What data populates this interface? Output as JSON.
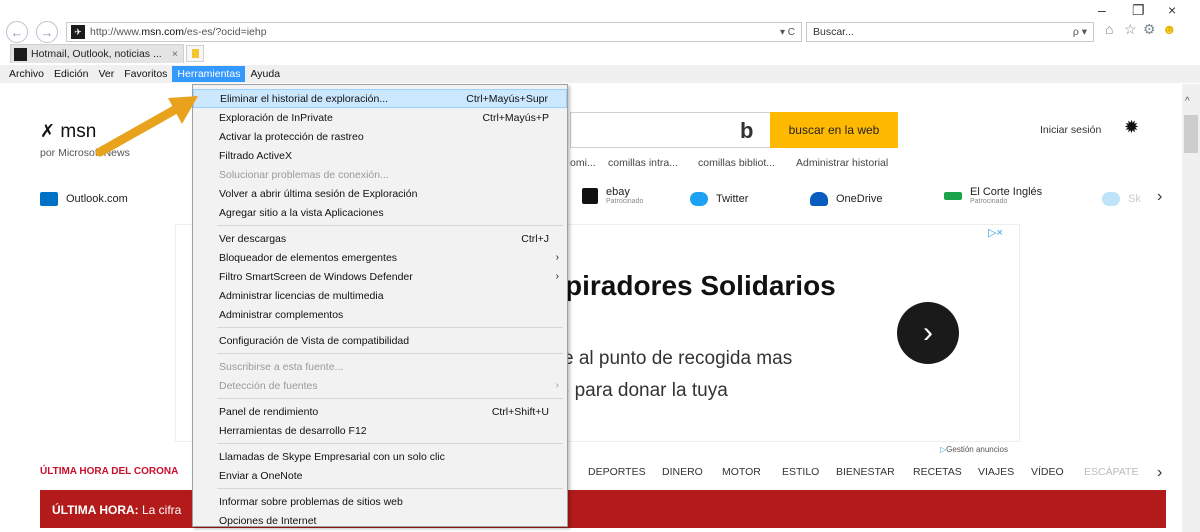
{
  "browser": {
    "url_prefix": "http://www.",
    "url_domain": "msn.com",
    "url_rest": "/es-es/?ocid=iehp",
    "address_controls": "▾ C",
    "search_placeholder": "Buscar...",
    "search_controls": "ρ ▾",
    "tab_title": "Hotmail, Outlook, noticias ...",
    "tab_close": "×",
    "window_controls": {
      "minimize": "–",
      "restore": "❐",
      "close": "×"
    },
    "nav_back": "←",
    "nav_forward": "→"
  },
  "menubar": [
    "Archivo",
    "Edición",
    "Ver",
    "Favoritos",
    "Herramientas",
    "Ayuda"
  ],
  "menubar_active": "Herramientas",
  "tools_menu": [
    {
      "label": "Eliminar el historial de exploración...",
      "shortcut": "Ctrl+Mayús+Supr",
      "highlight": true
    },
    {
      "label": "Exploración de InPrivate",
      "shortcut": "Ctrl+Mayús+P"
    },
    {
      "label": "Activar la protección de rastreo",
      "shortcut": ""
    },
    {
      "label": "Filtrado ActiveX",
      "shortcut": ""
    },
    {
      "label": "Solucionar problemas de conexión...",
      "shortcut": "",
      "disabled": true
    },
    {
      "label": "Volver a abrir última sesión de Exploración",
      "shortcut": ""
    },
    {
      "label": "Agregar sitio a la vista Aplicaciones",
      "shortcut": ""
    },
    {
      "label": "Ver descargas",
      "shortcut": "Ctrl+J"
    },
    {
      "label": "Bloqueador de elementos emergentes",
      "shortcut": "",
      "submenu": true
    },
    {
      "label": "Filtro SmartScreen de Windows Defender",
      "shortcut": "",
      "submenu": true
    },
    {
      "label": "Administrar licencias de multimedia",
      "shortcut": ""
    },
    {
      "label": "Administrar complementos",
      "shortcut": ""
    },
    {
      "label": "Configuración de Vista de compatibilidad",
      "shortcut": ""
    },
    {
      "label": "Suscribirse a esta fuente...",
      "shortcut": "",
      "disabled": true
    },
    {
      "label": "Detección de fuentes",
      "shortcut": "",
      "disabled": true,
      "submenu": true
    },
    {
      "label": "Panel de rendimiento",
      "shortcut": "Ctrl+Shift+U"
    },
    {
      "label": "Herramientas de desarrollo F12",
      "shortcut": ""
    },
    {
      "label": "Llamadas de Skype Empresarial con un solo clic",
      "shortcut": ""
    },
    {
      "label": "Enviar a OneNote",
      "shortcut": ""
    },
    {
      "label": "Informar sobre problemas de sitios web",
      "shortcut": ""
    },
    {
      "label": "Opciones de Internet",
      "shortcut": ""
    }
  ],
  "page": {
    "logo": "msn",
    "sublogo": "por Microsoft News",
    "search_button": "buscar en la web",
    "signin": "Iniciar sesión",
    "quick_links": [
      "omi...",
      "comillas intra...",
      "comillas bibliot...",
      "Administrar historial"
    ],
    "shortcuts": [
      {
        "label": "Outlook.com",
        "sponsored": ""
      },
      {
        "label": "ebay",
        "sponsored": "Patrocinado"
      },
      {
        "label": "Twitter",
        "sponsored": ""
      },
      {
        "label": "OneDrive",
        "sponsored": ""
      },
      {
        "label": "El Corte Inglés",
        "sponsored": "Patrocinado"
      },
      {
        "label": "Sk",
        "sponsored": ""
      }
    ],
    "ad_title": "piradores Solidarios",
    "ad_line1": "e al punto de recogida mas",
    "ad_line2": ") para donar la tuya",
    "ad_gestion": "Gestión anuncios",
    "breaking_tag": "ÚLTIMA HORA DEL CORONA",
    "nav_categories": [
      "DEPORTES",
      "DINERO",
      "MOTOR",
      "ESTILO",
      "BIENESTAR",
      "RECETAS",
      "VIAJES",
      "VÍDEO",
      "ESCÁPATE"
    ],
    "breaking_label": "ÚLTIMA HORA:",
    "breaking_text": "La cifra"
  },
  "colors": {
    "menu_highlight": "#cce8ff",
    "menubar_active": "#3399ff",
    "search_button": "#ffb900",
    "breaking_bar": "#b31b1b",
    "arrow": "#e8a21c"
  }
}
